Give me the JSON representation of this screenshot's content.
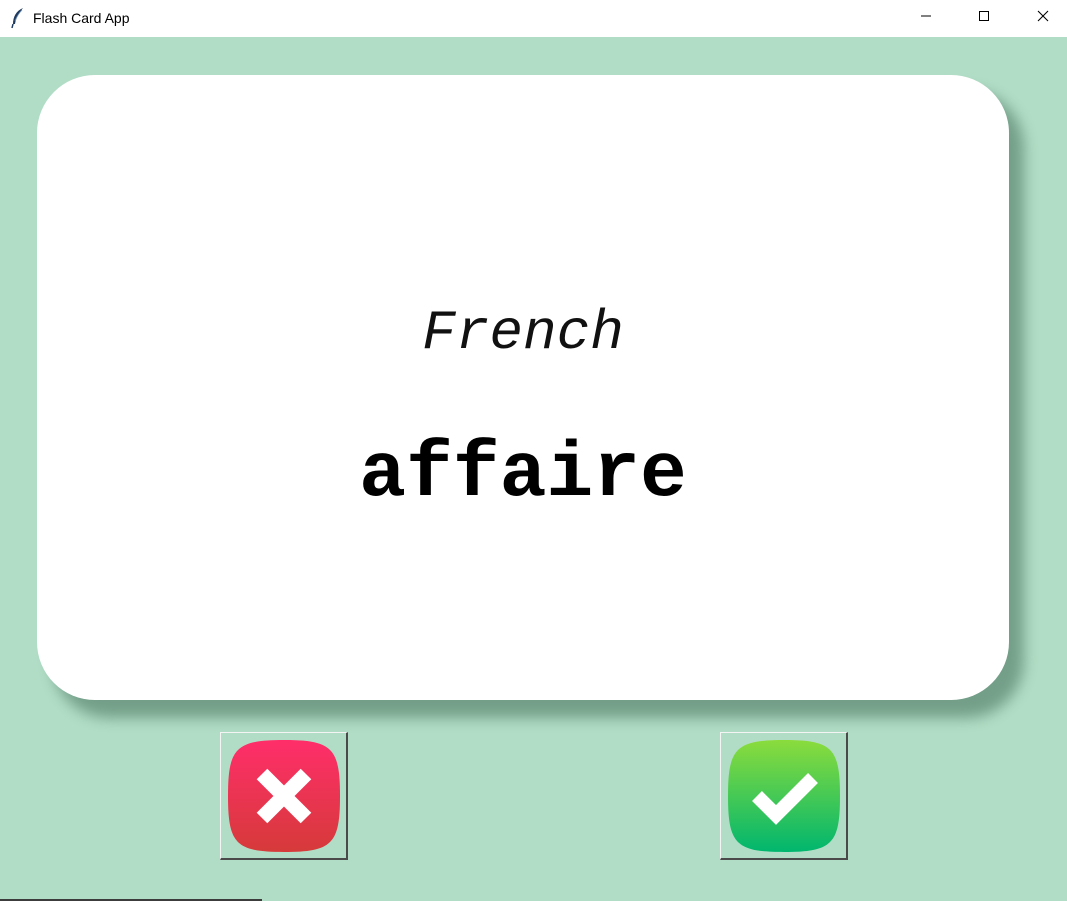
{
  "window": {
    "title": "Flash Card App",
    "background_color": "#b1ddc6",
    "app_icon": "feather-icon",
    "controls": {
      "minimize_icon": "minimize-icon",
      "maximize_icon": "maximize-icon",
      "close_icon": "close-icon"
    }
  },
  "card": {
    "language": "French",
    "word": "affaire",
    "background_color": "#ffffff"
  },
  "buttons": {
    "wrong": {
      "icon": "x-mark-icon",
      "color": "#e8344e"
    },
    "right": {
      "icon": "check-mark-icon",
      "color": "#2fc363"
    }
  }
}
